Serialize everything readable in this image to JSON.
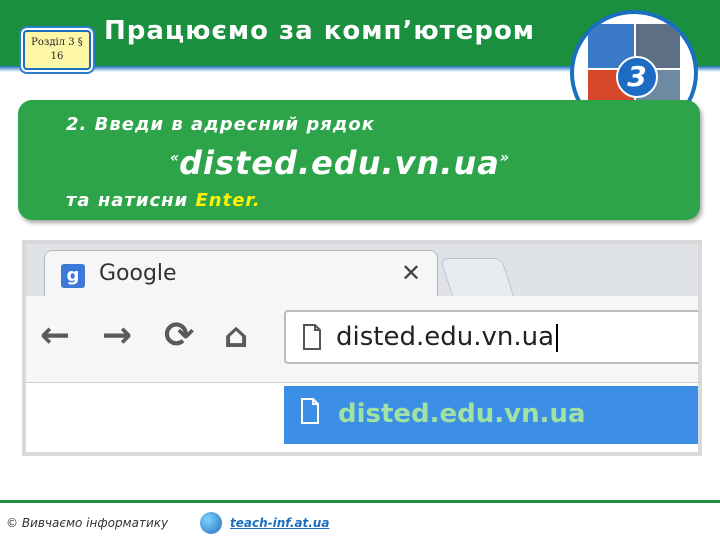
{
  "header": {
    "section_label": "Розділ 3 § 16",
    "title": "Працюємо за комп’ютером",
    "logo_number": "3",
    "colors": {
      "bar": "#1a8f3d",
      "accent": "#1a6fbf"
    }
  },
  "instruction": {
    "line1": "2. Введи в адресний рядок",
    "quote_open": "«",
    "url": "disted.edu.vn.ua",
    "quote_close": "»",
    "line3_prefix": "та натисни",
    "enter_word": "Enter.",
    "colors": {
      "box": "#2ea44a",
      "highlight": "#fff200"
    }
  },
  "browser": {
    "tab": {
      "title": "Google",
      "favicon": "g-icon",
      "close_icon": "close-icon"
    },
    "toolbar": {
      "back_icon": "arrow-left-icon",
      "forward_icon": "arrow-right-icon",
      "reload_icon": "reload-icon",
      "home_icon": "home-icon"
    },
    "address_bar": {
      "value": "disted.edu.vn.ua",
      "page_icon": "page-icon"
    },
    "suggestion": {
      "text": "disted.edu.vn.ua",
      "page_icon": "page-icon"
    }
  },
  "footer": {
    "copyright": "© Вивчаємо інформатику",
    "link": "teach-inf.at.ua"
  }
}
